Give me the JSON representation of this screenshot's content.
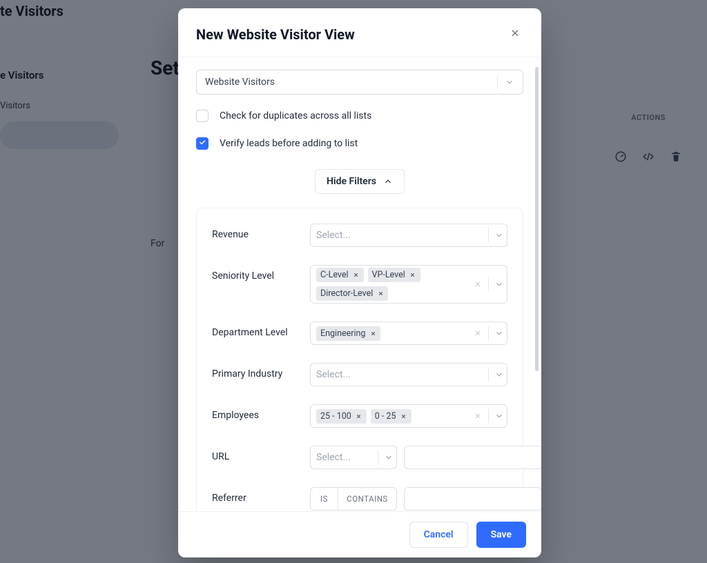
{
  "bg": {
    "sidebar_title_fragment": "te Visitors",
    "sidebar_subtitle_fragment": "e Visitors",
    "sidebar_item_fragment": "Visitors",
    "page_heading_fragment": "Set",
    "hint_fragment": "For",
    "actions_label": "ACTIONS"
  },
  "modal": {
    "title": "New Website Visitor View",
    "list_select": {
      "value": "Website Visitors"
    },
    "checkbox_duplicates": {
      "label": "Check for duplicates across all lists",
      "checked": false
    },
    "checkbox_verify": {
      "label": "Verify leads before adding to list",
      "checked": true
    },
    "hide_filters_label": "Hide Filters",
    "filters": {
      "revenue": {
        "label": "Revenue",
        "placeholder": "Select...",
        "tags": []
      },
      "seniority": {
        "label": "Seniority Level",
        "placeholder": "",
        "tags": [
          "C-Level",
          "VP-Level",
          "Director-Level"
        ]
      },
      "department": {
        "label": "Department Level",
        "placeholder": "",
        "tags": [
          "Engineering"
        ]
      },
      "primary_industry": {
        "label": "Primary Industry",
        "placeholder": "Select...",
        "tags": []
      },
      "employees": {
        "label": "Employees",
        "placeholder": "",
        "tags": [
          "25 - 100",
          "0 - 25"
        ]
      },
      "url": {
        "label": "URL",
        "placeholder": "Select...",
        "value": ""
      },
      "referrer": {
        "label": "Referrer",
        "seg_a": "IS",
        "seg_b": "CONTAINS",
        "value": ""
      }
    },
    "buttons": {
      "cancel": "Cancel",
      "save": "Save"
    }
  }
}
